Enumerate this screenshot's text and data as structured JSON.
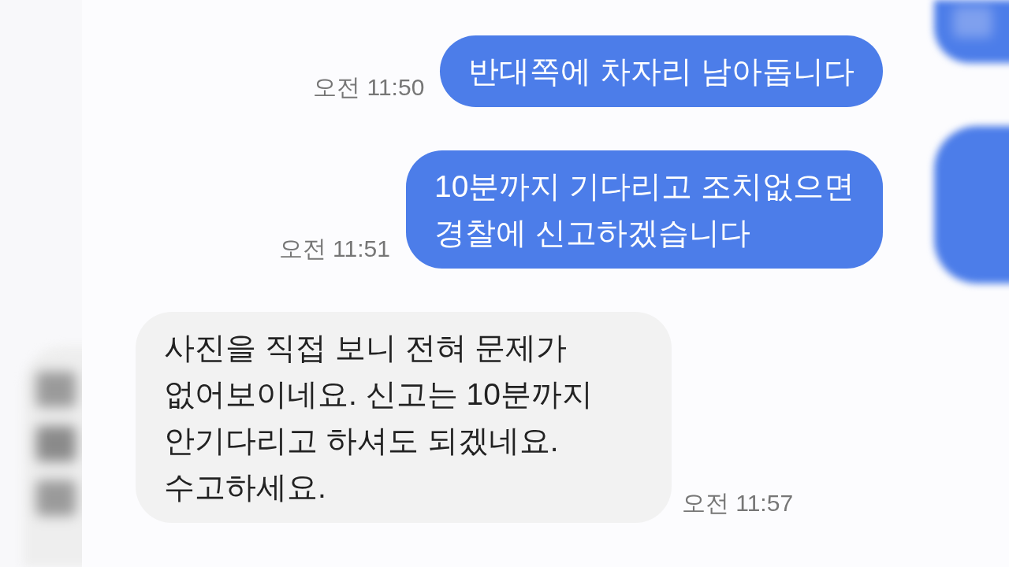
{
  "messages": [
    {
      "kind": "outgoing",
      "text": "반대쪽에 차자리 남아돕니다",
      "time": "오전 11:50"
    },
    {
      "kind": "outgoing",
      "text": "10분까지 기다리고 조치없으면\n경찰에 신고하겠습니다",
      "time": "오전 11:51"
    },
    {
      "kind": "incoming",
      "text": "사진을 직접 보니 전혀 문제가\n없어보이네요. 신고는 10분까지\n안기다리고 하셔도 되겠네요.\n수고하세요.",
      "time": "오전 11:57"
    }
  ]
}
